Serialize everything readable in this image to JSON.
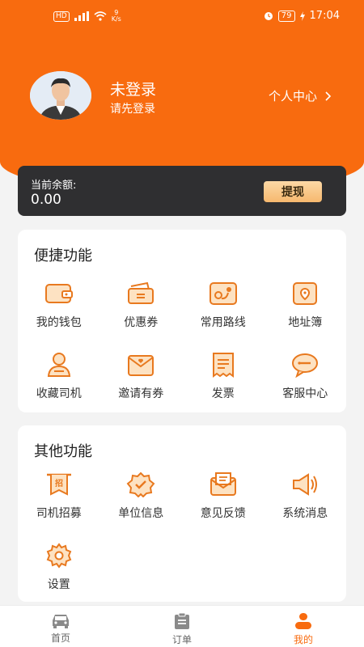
{
  "status_bar": {
    "left_chip": "HD",
    "net_speed_value": "9",
    "net_speed_unit": "K/s",
    "battery": "79",
    "time": "17:04"
  },
  "user": {
    "name": "未登录",
    "subtitle": "请先登录",
    "center_link": "个人中心"
  },
  "balance": {
    "label": "当前余额:",
    "amount": "0.00",
    "withdraw_label": "提现"
  },
  "quick_section": {
    "title": "便捷功能",
    "items": [
      {
        "label": "我的钱包",
        "icon": "wallet-icon"
      },
      {
        "label": "优惠券",
        "icon": "coupon-icon"
      },
      {
        "label": "常用路线",
        "icon": "route-icon"
      },
      {
        "label": "地址簿",
        "icon": "address-book-icon"
      },
      {
        "label": "收藏司机",
        "icon": "favorite-driver-icon"
      },
      {
        "label": "邀请有券",
        "icon": "invite-icon"
      },
      {
        "label": "发票",
        "icon": "invoice-icon"
      },
      {
        "label": "客服中心",
        "icon": "customer-service-icon"
      }
    ]
  },
  "other_section": {
    "title": "其他功能",
    "items": [
      {
        "label": "司机招募",
        "icon": "recruit-icon",
        "glyph": "招"
      },
      {
        "label": "单位信息",
        "icon": "company-info-icon"
      },
      {
        "label": "意见反馈",
        "icon": "feedback-icon"
      },
      {
        "label": "系统消息",
        "icon": "speaker-icon"
      },
      {
        "label": "设置",
        "icon": "gear-icon"
      }
    ]
  },
  "bottom_nav": [
    {
      "label": "首页",
      "icon": "car-icon",
      "active": false
    },
    {
      "label": "订单",
      "icon": "clipboard-icon",
      "active": false
    },
    {
      "label": "我的",
      "icon": "user-icon",
      "active": true
    }
  ],
  "colors": {
    "accent": "#f86b0f",
    "card_dark": "#2f2f31",
    "icon_orange": "#e8791f",
    "icon_fill": "#fde2c2"
  }
}
